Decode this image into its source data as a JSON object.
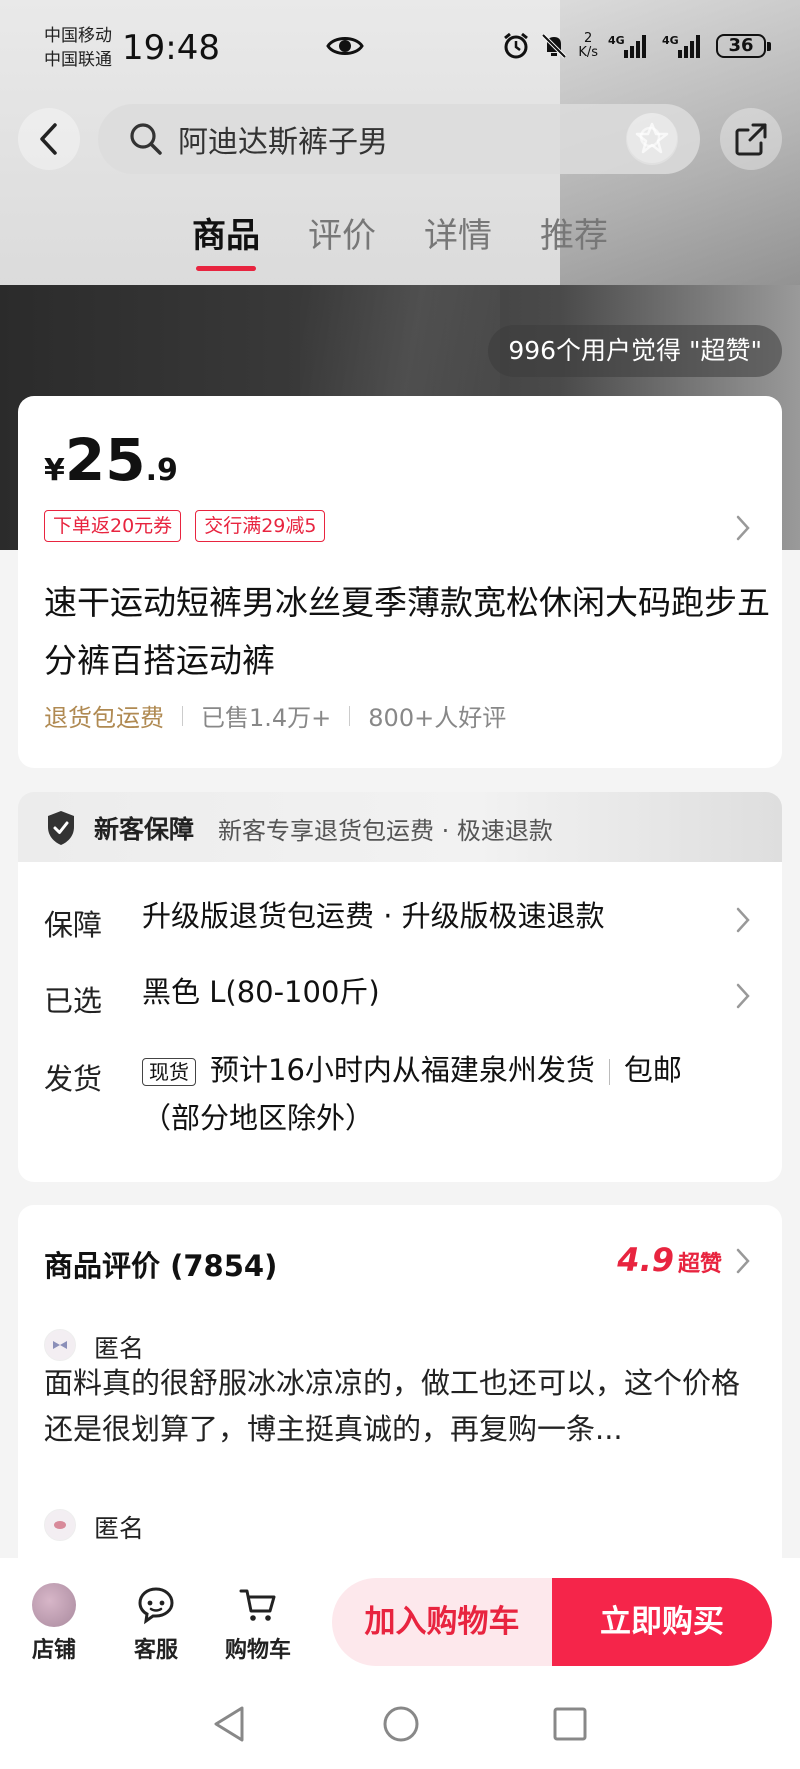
{
  "status_bar": {
    "carrier_1": "中国移动",
    "carrier_2": "中国联通",
    "time": "19:48",
    "speed_value": "2",
    "speed_unit": "K/s",
    "net_1": "4G",
    "net_2": "4G",
    "battery": "36"
  },
  "header": {
    "search_query": "阿迪达斯裤子男",
    "icons": [
      "back-icon",
      "search-icon",
      "share-icon"
    ]
  },
  "tabs": [
    {
      "label": "商品",
      "active": true
    },
    {
      "label": "评价",
      "active": false
    },
    {
      "label": "详情",
      "active": false
    },
    {
      "label": "推荐",
      "active": false
    }
  ],
  "hero": {
    "praise_text": "996个用户觉得 \"超赞\""
  },
  "product": {
    "currency": "¥",
    "price_int": "25",
    "price_dec": ".9",
    "coupons": [
      "下单返20元券",
      "交行满29减5"
    ],
    "title": "速干运动短裤男冰丝夏季薄款宽松休闲大码跑步五分裤百搭运动裤",
    "meta_return": "退货包运费",
    "meta_sold": "已售1.4万+",
    "meta_good": "800+人好评"
  },
  "guarantee": {
    "title": "新客保障",
    "desc": "新客专享退货包运费 · 极速退款"
  },
  "service": {
    "baozhang_label": "保障",
    "baozhang_value": "升级版退货包运费 · 升级版极速退款",
    "selected_label": "已选",
    "selected_value": "黑色 L(80-100斤)",
    "ship_label": "发货",
    "ship_tag": "现货",
    "ship_value": "预计16小时内从福建泉州发货",
    "ship_free": "包邮",
    "ship_note": "（部分地区除外）"
  },
  "reviews": {
    "heading": "商品评价 (7854)",
    "score": "4.9",
    "score_label": "超赞",
    "items": [
      {
        "user": "匿名",
        "text": "面料真的很舒服冰冰凉凉的，做工也还可以，这个价格还是很划算了，博主挺真诚的，再复购一条..."
      },
      {
        "user": "匿名"
      }
    ]
  },
  "bottom_bar": {
    "store": "店铺",
    "service": "客服",
    "cart": "购物车",
    "add_cart": "加入购物车",
    "buy_now": "立即购买"
  },
  "colors": {
    "accent": "#e8243f",
    "gold": "#b08a52"
  }
}
